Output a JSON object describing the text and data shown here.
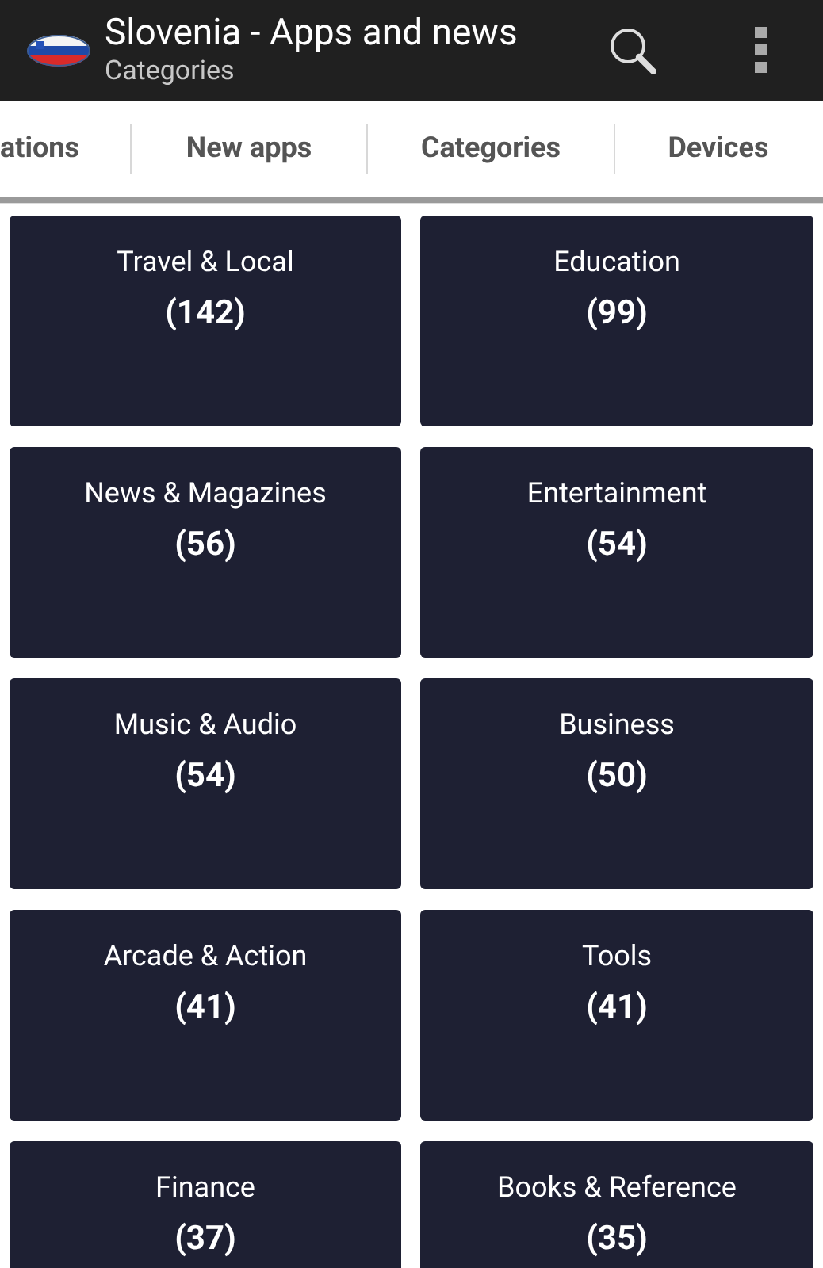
{
  "app_bar": {
    "title": "Slovenia - Apps and news",
    "subtitle": "Categories"
  },
  "tabs": [
    {
      "label": "ations"
    },
    {
      "label": "New apps"
    },
    {
      "label": "Categories"
    },
    {
      "label": "Devices"
    }
  ],
  "categories": [
    {
      "name": "Travel & Local",
      "count": "(142)"
    },
    {
      "name": "Education",
      "count": "(99)"
    },
    {
      "name": "News & Magazines",
      "count": "(56)"
    },
    {
      "name": "Entertainment",
      "count": "(54)"
    },
    {
      "name": "Music & Audio",
      "count": "(54)"
    },
    {
      "name": "Business",
      "count": "(50)"
    },
    {
      "name": "Arcade & Action",
      "count": "(41)"
    },
    {
      "name": "Tools",
      "count": "(41)"
    },
    {
      "name": "Finance",
      "count": "(37)"
    },
    {
      "name": "Books & Reference",
      "count": "(35)"
    }
  ]
}
